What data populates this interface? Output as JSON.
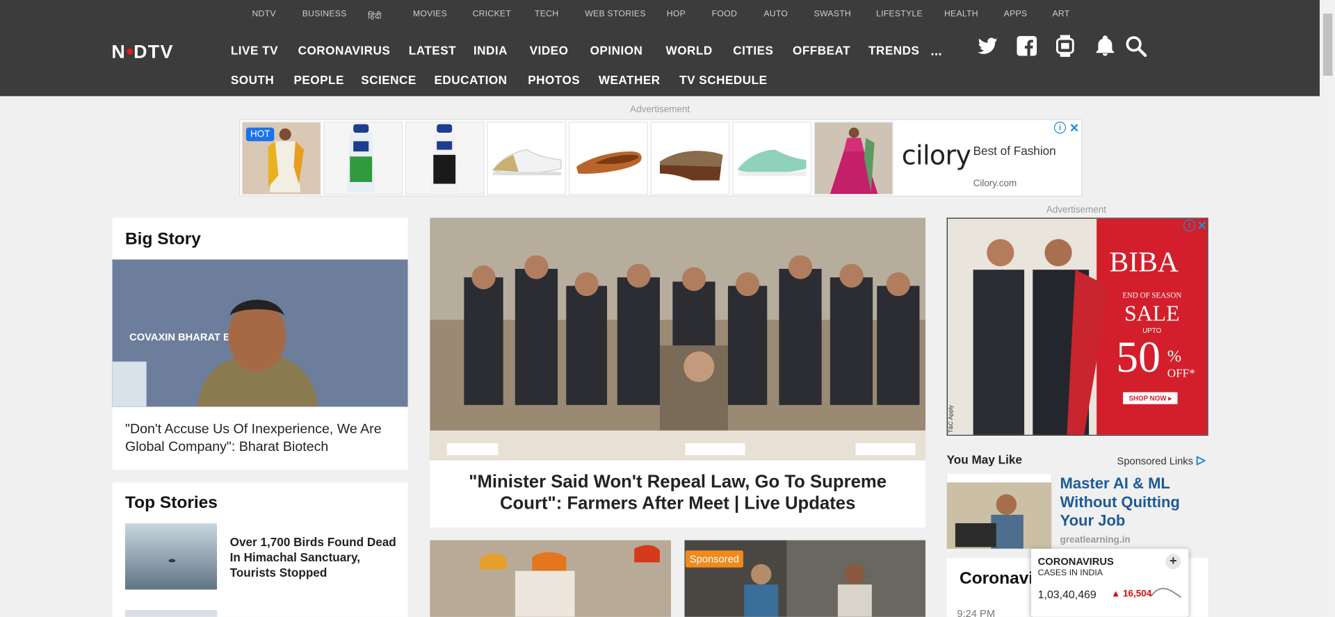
{
  "subnav": [
    "NDTV",
    "BUSINESS",
    "हिंदी",
    "MOVIES",
    "CRICKET",
    "TECH",
    "WEB STORIES",
    "HOP",
    "FOOD",
    "AUTO",
    "SWASTH",
    "LIFESTYLE",
    "HEALTH",
    "APPS",
    "ART"
  ],
  "logo": {
    "left": "N",
    "right": "DTV"
  },
  "nav_row1": [
    "LIVE TV",
    "CORONAVIRUS",
    "LATEST",
    "INDIA",
    "VIDEO",
    "OPINION",
    "WORLD",
    "CITIES",
    "OFFBEAT",
    "TRENDS"
  ],
  "nav_more": "...",
  "nav_row2": [
    "SOUTH",
    "PEOPLE",
    "SCIENCE",
    "EDUCATION",
    "PHOTOS",
    "WEATHER",
    "TV SCHEDULE"
  ],
  "header_icons": [
    "twitter-icon",
    "facebook-icon",
    "smartwatch-icon",
    "bell-icon",
    "search-icon"
  ],
  "ad_label": "Advertisement",
  "banner_ad": {
    "badge": "HOT",
    "brand": "cilory",
    "title": "Best of Fashion",
    "url": "Cilory.com"
  },
  "big_story": {
    "section": "Big Story",
    "headline": "\"Don't Accuse Us Of Inexperience, We Are Global Company\": Bharat Biotech",
    "brand_text": "COVAXIN BHARAT BIOTECH"
  },
  "top_stories": {
    "section": "Top Stories",
    "items": [
      {
        "headline": "Over 1,700 Birds Found Dead In Himachal Sanctuary, Tourists Stopped"
      }
    ]
  },
  "lead": {
    "headline": "\"Minister Said Won't Repeal Law, Go To Supreme Court\": Farmers After Meet | Live Updates"
  },
  "sponsored_label": "Sponsored",
  "side_ad": {
    "brand": "BIBA",
    "line1": "END OF SEASON",
    "line2": "SALE",
    "line3": "UPTO",
    "pct": "50",
    "pct_sign": "%",
    "off": "OFF*",
    "cta": "SHOP NOW ▸",
    "tnc": "T&C Apply"
  },
  "you_may_like": {
    "title": "You May Like",
    "sponsored": "Sponsored Links",
    "item_title": "Master AI & ML Without Quitting Your Job",
    "item_source": "greatlearning.in"
  },
  "corona": {
    "title": "Coronavi",
    "time": "9:24 PM",
    "popup_title": "CORONAVIRUS",
    "popup_sub": "CASES IN INDIA",
    "cases": "1,03,40,469",
    "delta": "16,504",
    "plus": "+"
  },
  "colors": {
    "header_bg": "#3c3c3c",
    "accent_red": "#e21a22",
    "link_blue": "#1e5a96",
    "sponsored_orange": "#f08a1c"
  }
}
